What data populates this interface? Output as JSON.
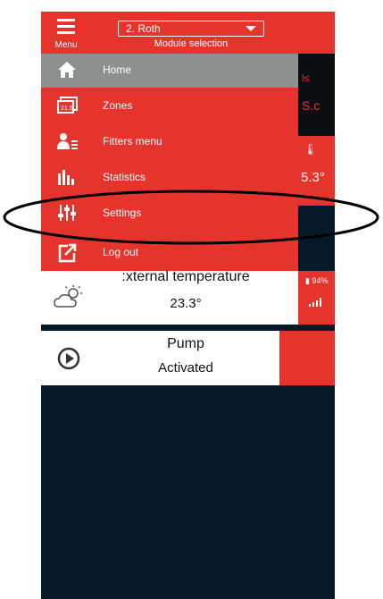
{
  "header": {
    "menu_label": "Menu",
    "module_value": "2. Roth",
    "module_caption": "Module selection"
  },
  "drawer": {
    "items": [
      {
        "label": "Home",
        "icon": "home-icon",
        "active": true
      },
      {
        "label": "Zones",
        "icon": "zones-icon",
        "active": false
      },
      {
        "label": "Fitters menu",
        "icon": "fitter-icon",
        "active": false
      },
      {
        "label": "Statistics",
        "icon": "statistics-icon",
        "active": false
      },
      {
        "label": "Settings",
        "icon": "settings-icon",
        "active": false
      },
      {
        "label": "Log out",
        "icon": "logout-icon",
        "active": false
      }
    ]
  },
  "background": {
    "temp_value": "5.3°",
    "battery": "94%"
  },
  "external_card": {
    "title": ":xternal temperature",
    "value": "23.3°"
  },
  "pump_card": {
    "title": "Pump",
    "value": "Activated"
  },
  "colors": {
    "accent": "#e5342c",
    "dark_bg": "#06192b",
    "active_item": "#8c9091"
  }
}
